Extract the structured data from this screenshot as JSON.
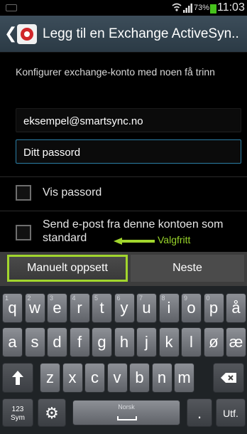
{
  "status": {
    "battery_pct": "73%",
    "time": "11:03"
  },
  "actionbar": {
    "title": "Legg til en Exchange ActiveSyn.."
  },
  "content": {
    "instruction": "Konfigurer exchange-konto med noen få trinn",
    "email_value": "eksempel@smartsync.no",
    "password_placeholder": "Ditt passord",
    "show_password_label": "Vis passord",
    "send_default_label": "Send e-post fra denne kontoen som standard",
    "annotation": "Valgfritt"
  },
  "buttons": {
    "manual": "Manuelt oppsett",
    "next": "Neste"
  },
  "keyboard": {
    "row1": [
      {
        "k": "q",
        "s": "1"
      },
      {
        "k": "w",
        "s": "2"
      },
      {
        "k": "e",
        "s": "3"
      },
      {
        "k": "r",
        "s": "4"
      },
      {
        "k": "t",
        "s": "5"
      },
      {
        "k": "y",
        "s": "6"
      },
      {
        "k": "u",
        "s": "7"
      },
      {
        "k": "i",
        "s": "8"
      },
      {
        "k": "o",
        "s": "9"
      },
      {
        "k": "p",
        "s": "0"
      },
      {
        "k": "å",
        "s": ""
      }
    ],
    "row2": [
      "a",
      "s",
      "d",
      "f",
      "g",
      "h",
      "j",
      "k",
      "l",
      "ø",
      "æ"
    ],
    "row3": [
      "z",
      "x",
      "c",
      "v",
      "b",
      "n",
      "m"
    ],
    "sym_label": "123\nSym",
    "space_label": "Norsk",
    "done_label": "Utf."
  },
  "colors": {
    "accent": "#a2d62d",
    "focus": "#2b7ea6",
    "battery": "#46c21c"
  }
}
